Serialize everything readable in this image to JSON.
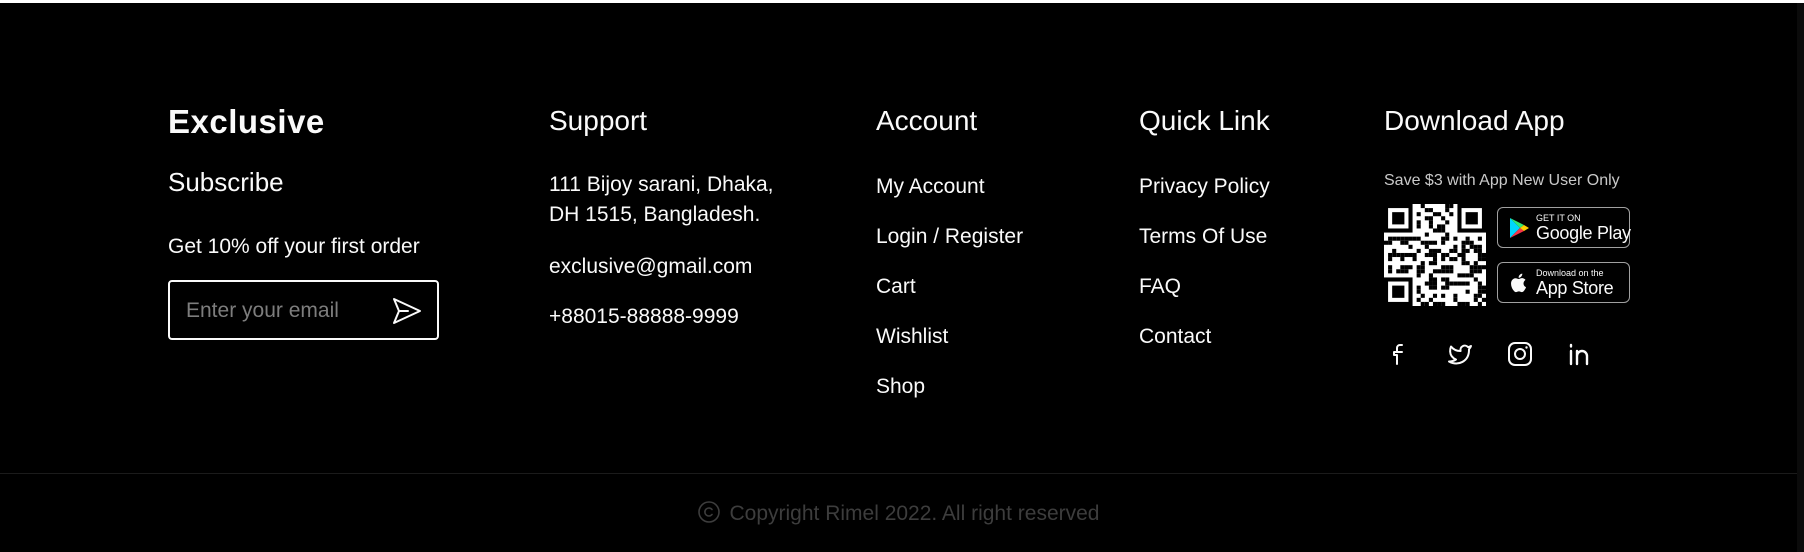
{
  "brand": {
    "name": "Exclusive"
  },
  "subscribe": {
    "heading": "Subscribe",
    "offer": "Get 10% off your first order",
    "email_placeholder": "Enter your email"
  },
  "support": {
    "heading": "Support",
    "address_line1": "111 Bijoy sarani, Dhaka,",
    "address_line2": "DH 1515, Bangladesh.",
    "email": "exclusive@gmail.com",
    "phone": "+88015-88888-9999"
  },
  "account": {
    "heading": "Account",
    "links": [
      "My Account",
      "Login / Register",
      "Cart",
      "Wishlist",
      "Shop"
    ]
  },
  "quick_link": {
    "heading": "Quick Link",
    "links": [
      "Privacy Policy",
      "Terms Of Use",
      "FAQ",
      "Contact"
    ]
  },
  "download_app": {
    "heading": "Download App",
    "promo": "Save $3 with App New User Only",
    "google_play": {
      "small": "GET IT ON",
      "big": "Google Play"
    },
    "app_store": {
      "small": "Download on the",
      "big": "App Store"
    }
  },
  "social_icons": [
    "facebook-icon",
    "twitter-icon",
    "instagram-icon",
    "linkedin-icon"
  ],
  "copyright": {
    "text": "Copyright Rimel 2022. All right reserved"
  },
  "colors": {
    "background": "#000000",
    "text": "#fafafa",
    "muted": "#7d7d7d",
    "copyright": "#3d3d3d"
  }
}
